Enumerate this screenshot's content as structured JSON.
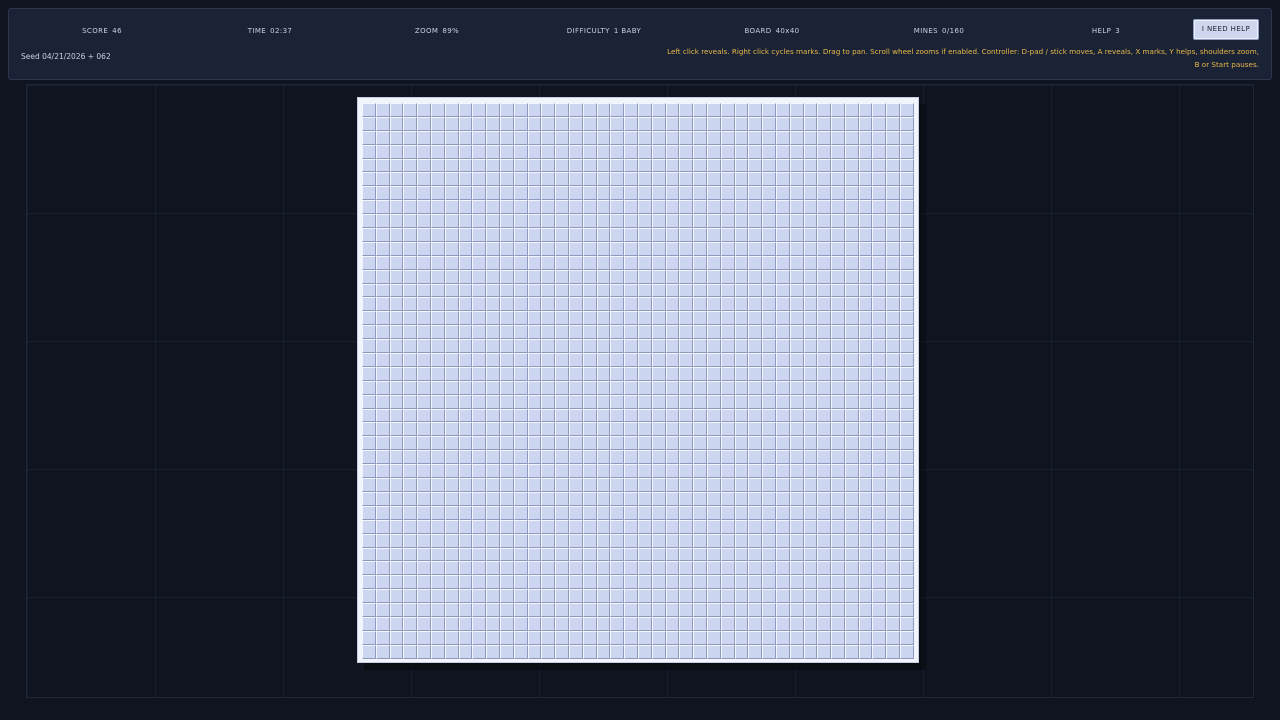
{
  "hud": {
    "score": {
      "label": "SCORE",
      "value": "46"
    },
    "time": {
      "label": "TIME",
      "value": "02:37"
    },
    "zoom": {
      "label": "ZOOM",
      "value": "89%"
    },
    "difficulty": {
      "label": "DIFFICULTY",
      "value": "1 BABY"
    },
    "board": {
      "label": "BOARD",
      "value": "40x40"
    },
    "mines": {
      "label": "MINES",
      "value": "0/160"
    },
    "help": {
      "label": "HELP",
      "value": "3"
    },
    "seed": "Seed  04/21/2026  +  062",
    "help_button_label": "I NEED HELP",
    "instructions_line1": "Left click reveals. Right click cycles marks. Drag to pan. Scroll wheel zooms if enabled. Controller: D-pad / stick moves, A reveals, X marks, Y helps, shoulders zoom,",
    "instructions_line2": "B or Start pauses."
  },
  "board": {
    "columns": 40,
    "rows": 40,
    "state": "all-hidden"
  },
  "colors": {
    "background": "#0f1420",
    "hud_panel": "#1a2235",
    "instructions_text": "#e8b84a",
    "cell_hidden": "#cdd6f0",
    "board_frame": "#f2f4fb"
  }
}
